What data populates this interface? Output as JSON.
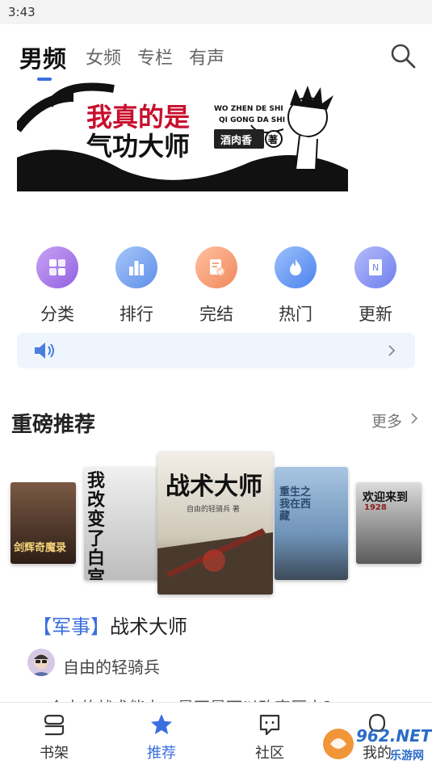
{
  "status_bar": {
    "time": "3:43"
  },
  "top_tabs": [
    {
      "label": "男频",
      "active": true
    },
    {
      "label": "女频",
      "active": false
    },
    {
      "label": "专栏",
      "active": false
    },
    {
      "label": "有声",
      "active": false
    }
  ],
  "banner": {
    "title_line1": "我真的是",
    "title_line2": "气功大师",
    "pinyin_line1": "WO ZHEN DE SHI",
    "pinyin_line2": "QI GONG DA SHI",
    "author": "酒肉香",
    "author_tag": "著"
  },
  "quick_links": [
    {
      "label": "分类",
      "icon": "grid-icon",
      "color": "#a77be8"
    },
    {
      "label": "排行",
      "icon": "ranking-icon",
      "color": "#6f9ff0"
    },
    {
      "label": "完结",
      "icon": "document-check-icon",
      "color": "#f59a73"
    },
    {
      "label": "热门",
      "icon": "flame-icon",
      "color": "#5a93f0"
    },
    {
      "label": "更新",
      "icon": "notebook-icon",
      "color": "#7f8ef2"
    }
  ],
  "section": {
    "title": "重磅推荐",
    "more_label": "更多"
  },
  "books": [
    {
      "title": "剑辉奇魔录",
      "cover_color": "#4a3328"
    },
    {
      "title": "我改变了白宫",
      "cover_color": "#d8d8d8"
    },
    {
      "title": "战术大师",
      "cover_color": "#e9e5dc",
      "subtitle": "自由的轻骑兵 著"
    },
    {
      "title": "重生之我在西藏",
      "cover_color": "#8fb0cf"
    },
    {
      "title": "欢迎来到",
      "subtitle": "1928",
      "cover_color": "#555555"
    }
  ],
  "featured": {
    "genre": "【军事】",
    "title": "战术大师",
    "author": "自由的轻骑兵",
    "description": "一个人的战术能力，是不是可以改变历史?"
  },
  "bottom_nav": [
    {
      "label": "书架",
      "icon": "bookshelf-icon",
      "active": false
    },
    {
      "label": "推荐",
      "icon": "star-icon",
      "active": true
    },
    {
      "label": "社区",
      "icon": "chat-icon",
      "active": false
    },
    {
      "label": "我的",
      "icon": "profile-icon",
      "active": false
    }
  ],
  "watermark": {
    "text": "962.NET",
    "subtext": "乐游网"
  },
  "colors": {
    "accent": "#3b6fe0",
    "notice_bg": "#eef5fc"
  }
}
